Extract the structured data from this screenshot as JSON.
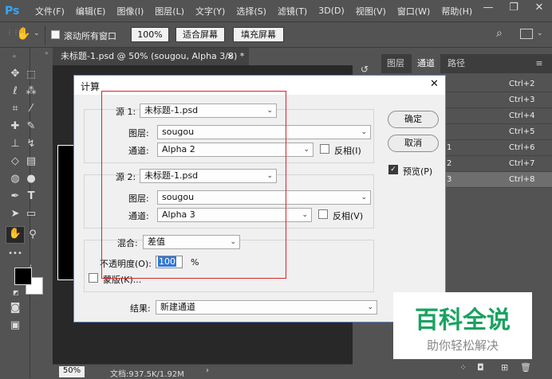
{
  "menubar": {
    "logo": "Ps",
    "items": [
      "文件(F)",
      "编辑(E)",
      "图像(I)",
      "图层(L)",
      "文字(Y)",
      "选择(S)",
      "滤镜(T)",
      "3D(D)",
      "视图(V)",
      "窗口(W)",
      "帮助(H)"
    ],
    "minimize": "—",
    "restore": "❐",
    "close": "✕"
  },
  "options": {
    "scroll_all_label": "滚动所有窗口",
    "zoom_value": "100%",
    "fit_screen": "适合屏幕",
    "fill_screen": "填充屏幕"
  },
  "document": {
    "tab_title": "未标题-1.psd @ 50% (sougou, Alpha 3/8) *",
    "tab_close": "×",
    "zoom": "50%",
    "doc_info": "文档:937.5K/1.92M",
    "status_arrow": "›"
  },
  "panels": {
    "tabs": [
      "图层",
      "通道",
      "路径"
    ],
    "channels": [
      {
        "name": "",
        "shortcut": "Ctrl+2"
      },
      {
        "name": "",
        "shortcut": "Ctrl+3"
      },
      {
        "name": "",
        "shortcut": "Ctrl+4"
      },
      {
        "name": "",
        "shortcut": "Ctrl+5"
      },
      {
        "name": "1",
        "shortcut": "Ctrl+6"
      },
      {
        "name": "2",
        "shortcut": "Ctrl+7"
      },
      {
        "name": "3",
        "shortcut": "Ctrl+8"
      }
    ]
  },
  "dialog": {
    "title": "计算",
    "source1": {
      "label": "源 1:",
      "file": "未标题-1.psd",
      "layer_label": "图层:",
      "layer": "sougou",
      "channel_label": "通道:",
      "channel": "Alpha 2",
      "invert_label": "反相(I)"
    },
    "source2": {
      "label": "源 2:",
      "file": "未标题-1.psd",
      "layer_label": "图层:",
      "layer": "sougou",
      "channel_label": "通道:",
      "channel": "Alpha 3",
      "invert_label": "反相(V)"
    },
    "blending": {
      "label": "混合:",
      "value": "差值"
    },
    "opacity": {
      "label": "不透明度(O):",
      "value": "100",
      "unit": "%"
    },
    "mask_label": "蒙版(K)...",
    "result": {
      "label": "结果:",
      "value": "新建通道"
    },
    "ok": "确定",
    "cancel": "取消",
    "preview_label": "预览(P)",
    "close": "✕"
  },
  "watermark": {
    "title": "百科全说",
    "subtitle": "助你轻松解决"
  },
  "colors": {
    "ui_bg": "#535353",
    "dialog_bg": "#f0f0f0",
    "highlight_box": "#d6262b",
    "logo_blue": "#31a8ff",
    "watermark_green": "#1aa260"
  }
}
